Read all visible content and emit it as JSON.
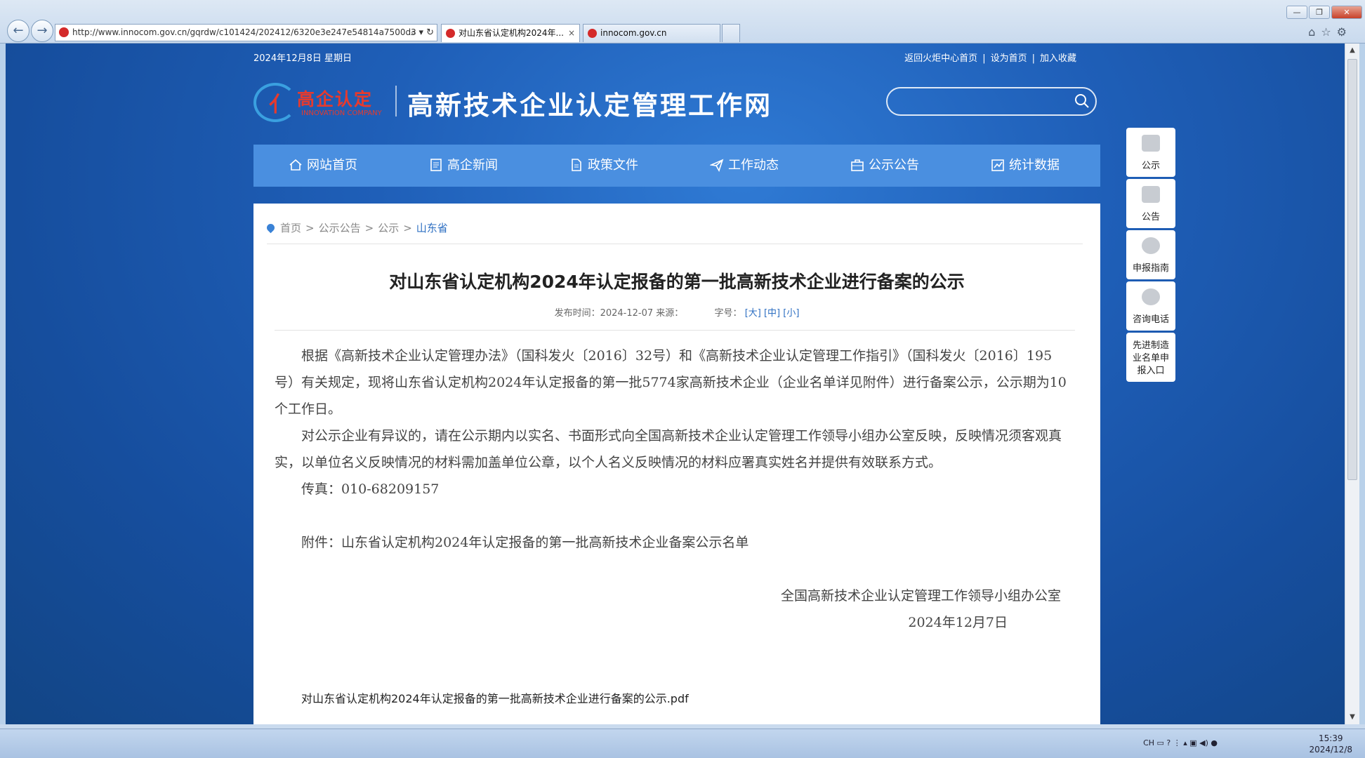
{
  "browser": {
    "url": "http://www.innocom.gov.cn/gqrdw/c101424/202412/6320e3e247e54814a7500d3",
    "tabs": [
      {
        "label": "对山东省认定机构2024年...",
        "active": true
      },
      {
        "label": "innocom.gov.cn",
        "active": false
      }
    ],
    "window_controls": {
      "minimize": "—",
      "restore": "❐",
      "close": "✕"
    }
  },
  "page": {
    "date": "2024年12月8日 星期日",
    "top_links": [
      "返回火炬中心首页",
      "设为首页",
      "加入收藏"
    ],
    "top_link_sep": "|",
    "logo": {
      "cn": "高企认定",
      "en": "INNOVATION COMPANY",
      "mark": "亻"
    },
    "site_title": "高新技术企业认定管理工作网",
    "search": {
      "placeholder": ""
    },
    "nav": [
      {
        "label": "网站首页",
        "icon": "home-icon"
      },
      {
        "label": "高企新闻",
        "icon": "news-icon"
      },
      {
        "label": "政策文件",
        "icon": "document-icon"
      },
      {
        "label": "工作动态",
        "icon": "send-icon"
      },
      {
        "label": "公示公告",
        "icon": "briefcase-icon"
      },
      {
        "label": "统计数据",
        "icon": "chart-icon"
      }
    ],
    "breadcrumb": {
      "items": [
        "首页",
        "公示公告",
        "公示"
      ],
      "current": "山东省",
      "sep": ">"
    },
    "article": {
      "title": "对山东省认定机构2024年认定报备的第一批高新技术企业进行备案的公示",
      "meta_time": "发布时间：2024-12-07 来源：",
      "meta_fontsize_label": "字号：",
      "font_sizes": [
        "[大]",
        "[中]",
        "[小]"
      ],
      "para1": "根据《高新技术企业认定管理办法》（国科发火〔2016〕32号）和《高新技术企业认定管理工作指引》（国科发火〔2016〕195号）有关规定，现将山东省认定机构2024年认定报备的第一批5774家高新技术企业（企业名单详见附件）进行备案公示，公示期为10个工作日。",
      "para2": "对公示企业有异议的，请在公示期内以实名、书面形式向全国高新技术企业认定管理工作领导小组办公室反映，反映情况须客观真实，以单位名义反映情况的材料需加盖单位公章，以个人名义反映情况的材料应署真实姓名并提供有效联系方式。",
      "fax": "传真：010-68209157",
      "attachment_note": "附件：山东省认定机构2024年认定报备的第一批高新技术企业备案公示名单",
      "signature": "全国高新技术企业认定管理工作领导小组办公室",
      "sign_date": "2024年12月7日",
      "attachment_file": "对山东省认定机构2024年认定报备的第一批高新技术企业进行备案的公示.pdf"
    },
    "sidebar": [
      {
        "label": "公示",
        "icon": "briefcase-icon"
      },
      {
        "label": "公告",
        "icon": "notepad-icon"
      },
      {
        "label": "申报指南",
        "icon": "compass-icon"
      },
      {
        "label": "咨询电话",
        "icon": "phone-icon"
      },
      {
        "label": "先进制造业名单申报入口",
        "icon": ""
      }
    ]
  },
  "taskbar": {
    "tray": "CH",
    "time": "15:39",
    "date": "2024/12/8"
  },
  "colors": {
    "nav_bg": "#4a8fe0",
    "page_bg": "#1f5fb8",
    "accent": "#2d6fc2",
    "logo_red": "#e63a2e"
  }
}
